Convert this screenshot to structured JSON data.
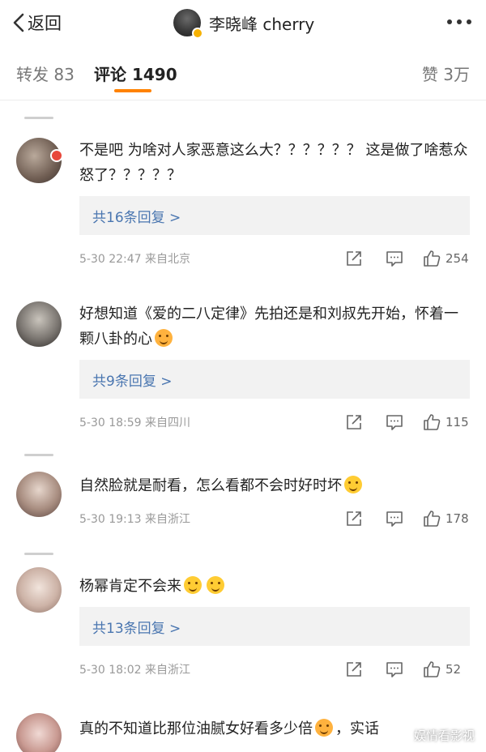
{
  "header": {
    "back_label": "返回",
    "title": "李晓峰 cherry"
  },
  "tabs": {
    "forward": "转发 83",
    "comment": "评论 1490",
    "like": "赞 3万"
  },
  "colors": {
    "accent": "#ff8200",
    "reply_link": "#4a76b0",
    "meta_gray": "#999999"
  },
  "comments": [
    {
      "text": "不是吧 为啥对人家恶意这么大？？？？？？ 这是做了啥惹众怒了？？？？？",
      "replies": "共16条回复 >",
      "meta": "5-30 22:47 来自北京",
      "likes": "254"
    },
    {
      "text": "好想知道《爱的二八定律》先拍还是和刘叔先开始，怀着一颗八卦的心",
      "emoji_after": "heart-kiss-emoji",
      "replies": "共9条回复 >",
      "meta": "5-30 18:59 来自四川",
      "likes": "115"
    },
    {
      "text": "自然脸就是耐看，怎么看都不会时好时坏",
      "emoji_after": "laugh-tears-emoji",
      "meta": "5-30 19:13 来自浙江",
      "likes": "178"
    },
    {
      "text": "杨幂肯定不会来",
      "emoji_after": "sad-face-emoji",
      "replies": "共13条回复 >",
      "meta": "5-30 18:02 来自浙江",
      "likes": "52"
    },
    {
      "text": "真的不知道比那位油腻女好看多少倍",
      "emoji_after": "heart-eyes-emoji",
      "tail": "，实话"
    }
  ],
  "watermark": "娱情看影视"
}
